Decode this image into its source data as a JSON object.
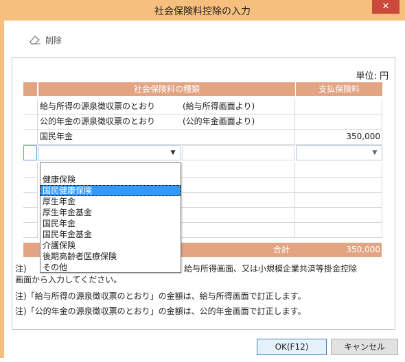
{
  "window": {
    "title": "社会保険料控除の入力",
    "close_glyph": "✕"
  },
  "toolbar": {
    "delete_label": "削除"
  },
  "unit_label": "単位: 円",
  "table": {
    "headers": {
      "type": "社会保険料の種類",
      "amount": "支払保険料"
    },
    "rows": [
      {
        "type": "給与所得の源泉徴収票のとおり",
        "note": "(給与所得画面より)",
        "amount": ""
      },
      {
        "type": "公的年金の源泉徴収票のとおり",
        "note": "(公的年金画面より)",
        "amount": ""
      },
      {
        "type": "国民年金",
        "note": "",
        "amount": "350,000"
      }
    ],
    "total_label": "合計",
    "total_value": "350,000"
  },
  "dropdown": {
    "options": [
      "",
      "健康保険",
      "国民健康保険",
      "厚生年金",
      "厚生年金基金",
      "国民年金",
      "国民年金基金",
      "介護保険",
      "後期高齢者医療保険",
      "その他"
    ],
    "highlighted": "国民健康保険"
  },
  "notes": {
    "note1_line1_prefix": "注)",
    "note1_line1_suffix": "給与所得画面、又は小規模企業共済等掛金控除",
    "note1_line2": "画面から入力してください。",
    "note2": "注)「給与所得の源泉徴収票のとおり」の金額は、給与所得画面で訂正します。",
    "note3": "注)「公的年金の源泉徴収票のとおり」の金額は、公的年金画面で訂正します。"
  },
  "buttons": {
    "ok": "OK(F12)",
    "cancel": "キャンセル"
  },
  "colors": {
    "frame": "#f7bf7d",
    "header_fill": "#e3a484",
    "close_button": "#c94a3c",
    "selection": "#3399ff"
  }
}
